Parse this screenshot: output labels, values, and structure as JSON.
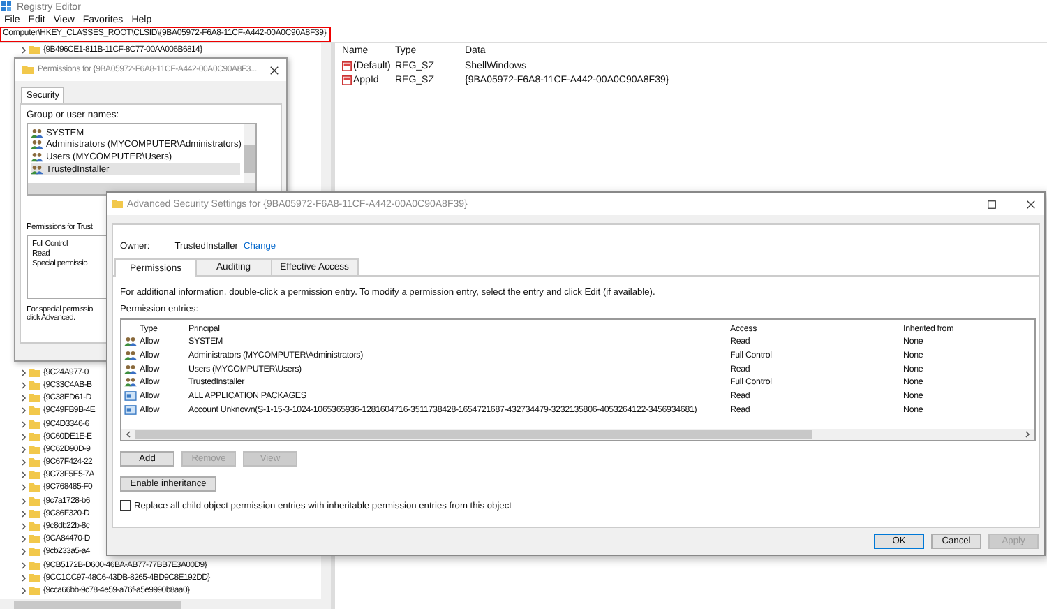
{
  "registry_editor": {
    "title": "Registry Editor",
    "menu": [
      "File",
      "Edit",
      "View",
      "Favorites",
      "Help"
    ],
    "address": "Computer\\HKEY_CLASSES_ROOT\\CLSID\\{9BA05972-F6A8-11CF-A442-00A0C90A8F39}",
    "tree_top": [
      "{9B496CE1-811B-11CF-8C77-00AA006B6814}"
    ],
    "tree_items": [
      "{9C24A977-0",
      "{9C33C4AB-B",
      "{9C38ED61-D",
      "{9C49FB9B-4E",
      "{9C4D3346-6",
      "{9C60DE1E-E",
      "{9C62D90D-9",
      "{9C67F424-22",
      "{9C73F5E5-7A",
      "{9C768485-F0",
      "{9c7a1728-b6",
      "{9C86F320-D",
      "{9c8db22b-8c",
      "{9CA84470-D",
      "{9cb233a5-a4",
      "{9CB5172B-D600-46BA-AB77-77BB7E3A00D9}",
      "{9CC1CC97-48C6-43DB-8265-4BD9C8E192DD}",
      "{9cca66bb-9c78-4e59-a76f-a5e9990b8aa0}"
    ],
    "value_columns": [
      "Name",
      "Type",
      "Data"
    ],
    "values": [
      {
        "name": "(Default)",
        "type": "REG_SZ",
        "data": "ShellWindows"
      },
      {
        "name": "AppId",
        "type": "REG_SZ",
        "data": "{9BA05972-F6A8-11CF-A442-00A0C90A8F39}"
      }
    ]
  },
  "permissions_dialog": {
    "title": "Permissions for {9BA05972-F6A8-11CF-A442-00A0C90A8F3...",
    "tab": "Security",
    "group_label": "Group or user names:",
    "users": [
      {
        "name": "SYSTEM",
        "selected": false
      },
      {
        "name": "Administrators (MYCOMPUTER\\Administrators)",
        "selected": false
      },
      {
        "name": "Users (MYCOMPUTER\\Users)",
        "selected": false
      },
      {
        "name": "TrustedInstaller",
        "selected": true
      }
    ],
    "permissions_label": "Permissions for Trust",
    "permissions": [
      "Full Control",
      "Read",
      "Special permissio"
    ],
    "note": [
      "For special permissio",
      "click Advanced."
    ]
  },
  "advanced_dialog": {
    "title": "Advanced Security Settings for {9BA05972-F6A8-11CF-A442-00A0C90A8F39}",
    "owner_label": "Owner:",
    "owner": "TrustedInstaller",
    "change_link": "Change",
    "tabs": [
      {
        "label": "Permissions",
        "selected": true
      },
      {
        "label": "Auditing",
        "selected": false
      },
      {
        "label": "Effective Access",
        "selected": false
      }
    ],
    "info": "For additional information, double-click a permission entry. To modify a permission entry, select the entry and click Edit (if available).",
    "entries_label": "Permission entries:",
    "columns": [
      "Type",
      "Principal",
      "Access",
      "Inherited from"
    ],
    "entries": [
      {
        "kind": "group",
        "type": "Allow",
        "principal": "SYSTEM",
        "access": "Read",
        "inherited_from": "None"
      },
      {
        "kind": "group",
        "type": "Allow",
        "principal": "Administrators (MYCOMPUTER\\Administrators)",
        "access": "Full Control",
        "inherited_from": "None"
      },
      {
        "kind": "group",
        "type": "Allow",
        "principal": "Users (MYCOMPUTER\\Users)",
        "access": "Read",
        "inherited_from": "None"
      },
      {
        "kind": "group",
        "type": "Allow",
        "principal": "TrustedInstaller",
        "access": "Full Control",
        "inherited_from": "None"
      },
      {
        "kind": "package",
        "type": "Allow",
        "principal": "ALL APPLICATION PACKAGES",
        "access": "Read",
        "inherited_from": "None"
      },
      {
        "kind": "package",
        "type": "Allow",
        "principal": "Account Unknown(S-1-15-3-1024-1065365936-1281604716-3511738428-1654721687-432734479-3232135806-4053264122-3456934681)",
        "access": "Read",
        "inherited_from": "None"
      }
    ],
    "buttons": [
      {
        "label": "Add",
        "disabled": false
      },
      {
        "label": "Remove",
        "disabled": true
      },
      {
        "label": "View",
        "disabled": true
      }
    ],
    "enable_inheritance": "Enable inheritance",
    "replace_checkbox": {
      "label": "Replace all child object permission entries with inheritable permission entries from this object",
      "checked": false
    },
    "footer_buttons": [
      {
        "label": "OK",
        "disabled": false,
        "default": true
      },
      {
        "label": "Cancel",
        "disabled": false,
        "default": false
      },
      {
        "label": "Apply",
        "disabled": true,
        "default": false
      }
    ]
  }
}
